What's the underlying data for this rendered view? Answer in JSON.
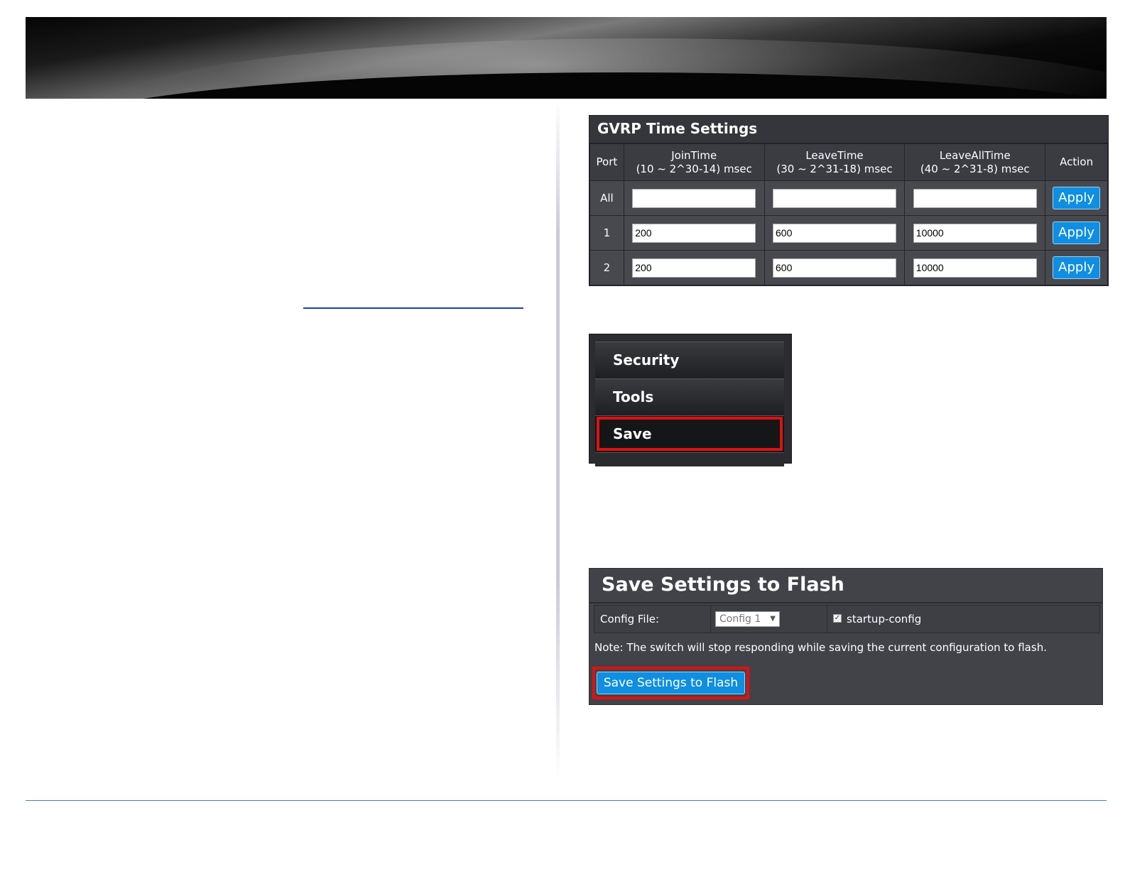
{
  "gvrp": {
    "title": "GVRP Time Settings",
    "headers": {
      "port": "Port",
      "join_line1": "JoinTime",
      "join_line2": "(10 ~ 2^30-14) msec",
      "leave_line1": "LeaveTime",
      "leave_line2": "(30 ~ 2^31-18) msec",
      "leaveall_line1": "LeaveAllTime",
      "leaveall_line2": "(40 ~ 2^31-8) msec",
      "action": "Action"
    },
    "rows": [
      {
        "port": "All",
        "join": "",
        "leave": "",
        "leaveall": "",
        "action": "Apply"
      },
      {
        "port": "1",
        "join": "200",
        "leave": "600",
        "leaveall": "10000",
        "action": "Apply"
      },
      {
        "port": "2",
        "join": "200",
        "leave": "600",
        "leaveall": "10000",
        "action": "Apply"
      }
    ]
  },
  "menu": {
    "items": [
      {
        "label": "Security"
      },
      {
        "label": "Tools"
      },
      {
        "label": "Save"
      }
    ],
    "highlighted": "Save"
  },
  "save": {
    "title": "Save Settings to Flash",
    "config_label": "Config File:",
    "config_value": "Config 1",
    "startup_label": "startup-config",
    "startup_checked": true,
    "note": "Note: The switch will stop responding while saving the current configuration to flash.",
    "button_label": "Save Settings to Flash"
  },
  "colors": {
    "accent_button": "#0f8ee2",
    "highlight_box": "#e01010",
    "panel_bg": "#3a3c42",
    "footer_line": "#3b7fd6"
  }
}
